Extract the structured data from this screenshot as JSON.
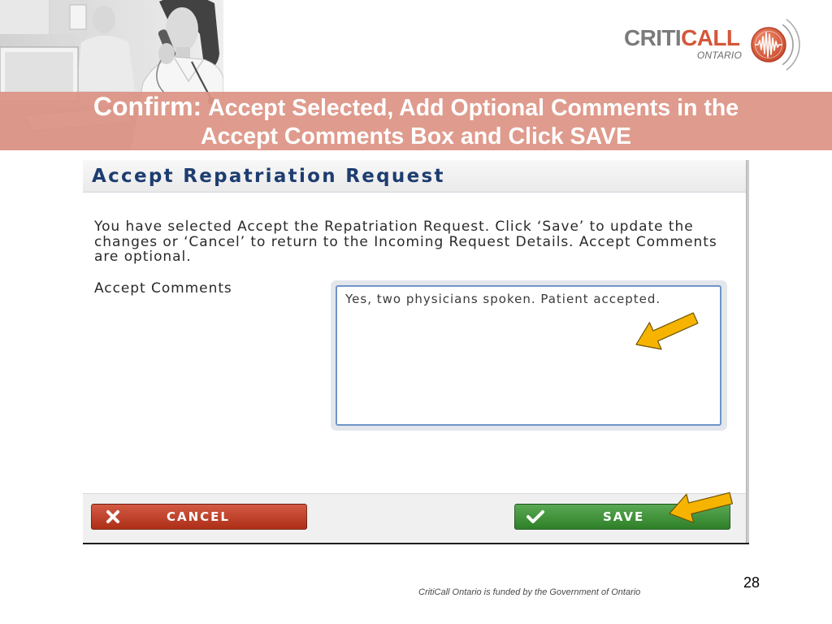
{
  "slide": {
    "title_prefix": "Confirm:",
    "title_line1": "Accept Selected, Add Optional Comments in the",
    "title_line2": "Accept Comments Box and Click SAVE",
    "page_number": "28",
    "footer_note": "CritiCall Ontario is funded by the Government of Ontario",
    "annotation_icon": "pointer-arrow-icon"
  },
  "logo": {
    "text_part1": "CRITI",
    "text_part2": "CALL",
    "subtext": "ONTARIO",
    "icon": "waveform-circle-icon"
  },
  "dialog": {
    "title": "Accept Repatriation Request",
    "message_lines": [
      "You have selected Accept the Repatriation Request. Click ‘Save’ to update the",
      "changes or ‘Cancel’ to return to the Incoming Request Details. Accept Comments",
      "are optional."
    ],
    "comments_label": "Accept Comments",
    "comments_value": "Yes, two physicians spoken. Patient accepted.",
    "cancel_button": {
      "label": "CANCEL",
      "icon": "close-x-icon"
    },
    "save_button": {
      "label": "SAVE",
      "icon": "checkmark-icon"
    }
  },
  "colors": {
    "banner": "#dc9383",
    "logo_gray": "#7b7b7b",
    "logo_red": "#d4573a",
    "dialog_title": "#1d3d70",
    "cancel_button": "#c9361b",
    "save_button": "#36952f",
    "textarea_border": "#6f95c8",
    "arrow": "#f6b400"
  }
}
